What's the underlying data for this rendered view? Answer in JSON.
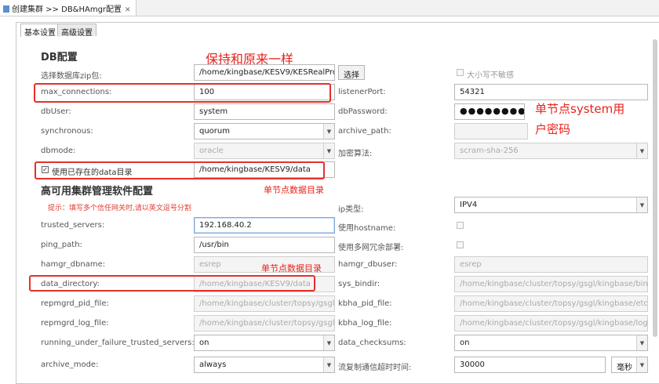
{
  "editor_tab": {
    "title": "创建集群 >> DB&HAmgr配置",
    "close": "✕"
  },
  "tabs": [
    "基本设置",
    "高级设置"
  ],
  "sections": {
    "db": "DB配置",
    "ha": "高可用集群管理软件配置"
  },
  "fields": {
    "zip_label": "选择数据库zip包:",
    "zip_value": "/home/kingbase/KESV9/KESRealPro",
    "select_button": "选择",
    "case_insensitive": "大小写不敏感",
    "max_conn_label": "max_connections:",
    "max_conn_value": "100",
    "listener_label": "listenerPort:",
    "listener_value": "54321",
    "dbuser_label": "dbUser:",
    "dbuser_value": "system",
    "dbpass_label": "dbPassword:",
    "dbpass_value": "●●●●●●●●",
    "sync_label": "synchronous:",
    "sync_value": "quorum",
    "archive_path_label": "archive_path:",
    "dbmode_label": "dbmode:",
    "dbmode_value": "oracle",
    "encrypt_label": "加密算法:",
    "encrypt_value": "scram-sha-256",
    "use_existing_label": "使用已存在的data目录",
    "use_existing_value": "/home/kingbase/KESV9/data",
    "hint": "提示：填写多个信任网关时,请以英文逗号分割",
    "ip_type_label": "ip类型:",
    "ip_type_value": "IPV4",
    "trusted_label": "trusted_servers:",
    "trusted_value": "192.168.40.2",
    "use_hostname_label": "使用hostname:",
    "ping_label": "ping_path:",
    "ping_value": "/usr/bin",
    "multi_net_label": "使用多网冗余部署:",
    "hamgr_db_label": "hamgr_dbname:",
    "hamgr_db_value": "esrep",
    "hamgr_user_label": "hamgr_dbuser:",
    "hamgr_user_value": "esrep",
    "data_dir_label": "data_directory:",
    "data_dir_value": "/home/kingbase/KESV9/data",
    "sys_bindir_label": "sys_bindir:",
    "sys_bindir_value": "/home/kingbase/cluster/topsy/gsgl/kingbase/bin",
    "repmgrd_pid_label": "repmgrd_pid_file:",
    "repmgrd_pid_value": "/home/kingbase/cluster/topsy/gsgl/",
    "kbha_pid_label": "kbha_pid_file:",
    "kbha_pid_value": "/home/kingbase/cluster/topsy/gsgl/kingbase/etc/",
    "repmgrd_log_label": "repmgrd_log_file:",
    "repmgrd_log_value": "/home/kingbase/cluster/topsy/gsgl/",
    "kbha_log_label": "kbha_log_file:",
    "kbha_log_value": "/home/kingbase/cluster/topsy/gsgl/kingbase/log/",
    "running_label": "running_under_failure_trusted_servers:",
    "running_value": "on",
    "checksums_label": "data_checksums:",
    "checksums_value": "on",
    "archive_mode_label": "archive_mode:",
    "archive_mode_value": "always",
    "stream_timeout_label": "流复制通信超时时间:",
    "stream_timeout_value": "30000",
    "stream_unit": "毫秒"
  },
  "annotations": {
    "keep_same": "保持和原来一样",
    "password_note_1": "单节点system用",
    "password_note_2": "户密码",
    "data_dir_note_1": "单节点数据目录",
    "data_dir_note_2": "单节点数据目录"
  },
  "icons": {
    "dropdown": "chevron-down-icon",
    "check": "check-icon",
    "doc": "document-icon"
  }
}
